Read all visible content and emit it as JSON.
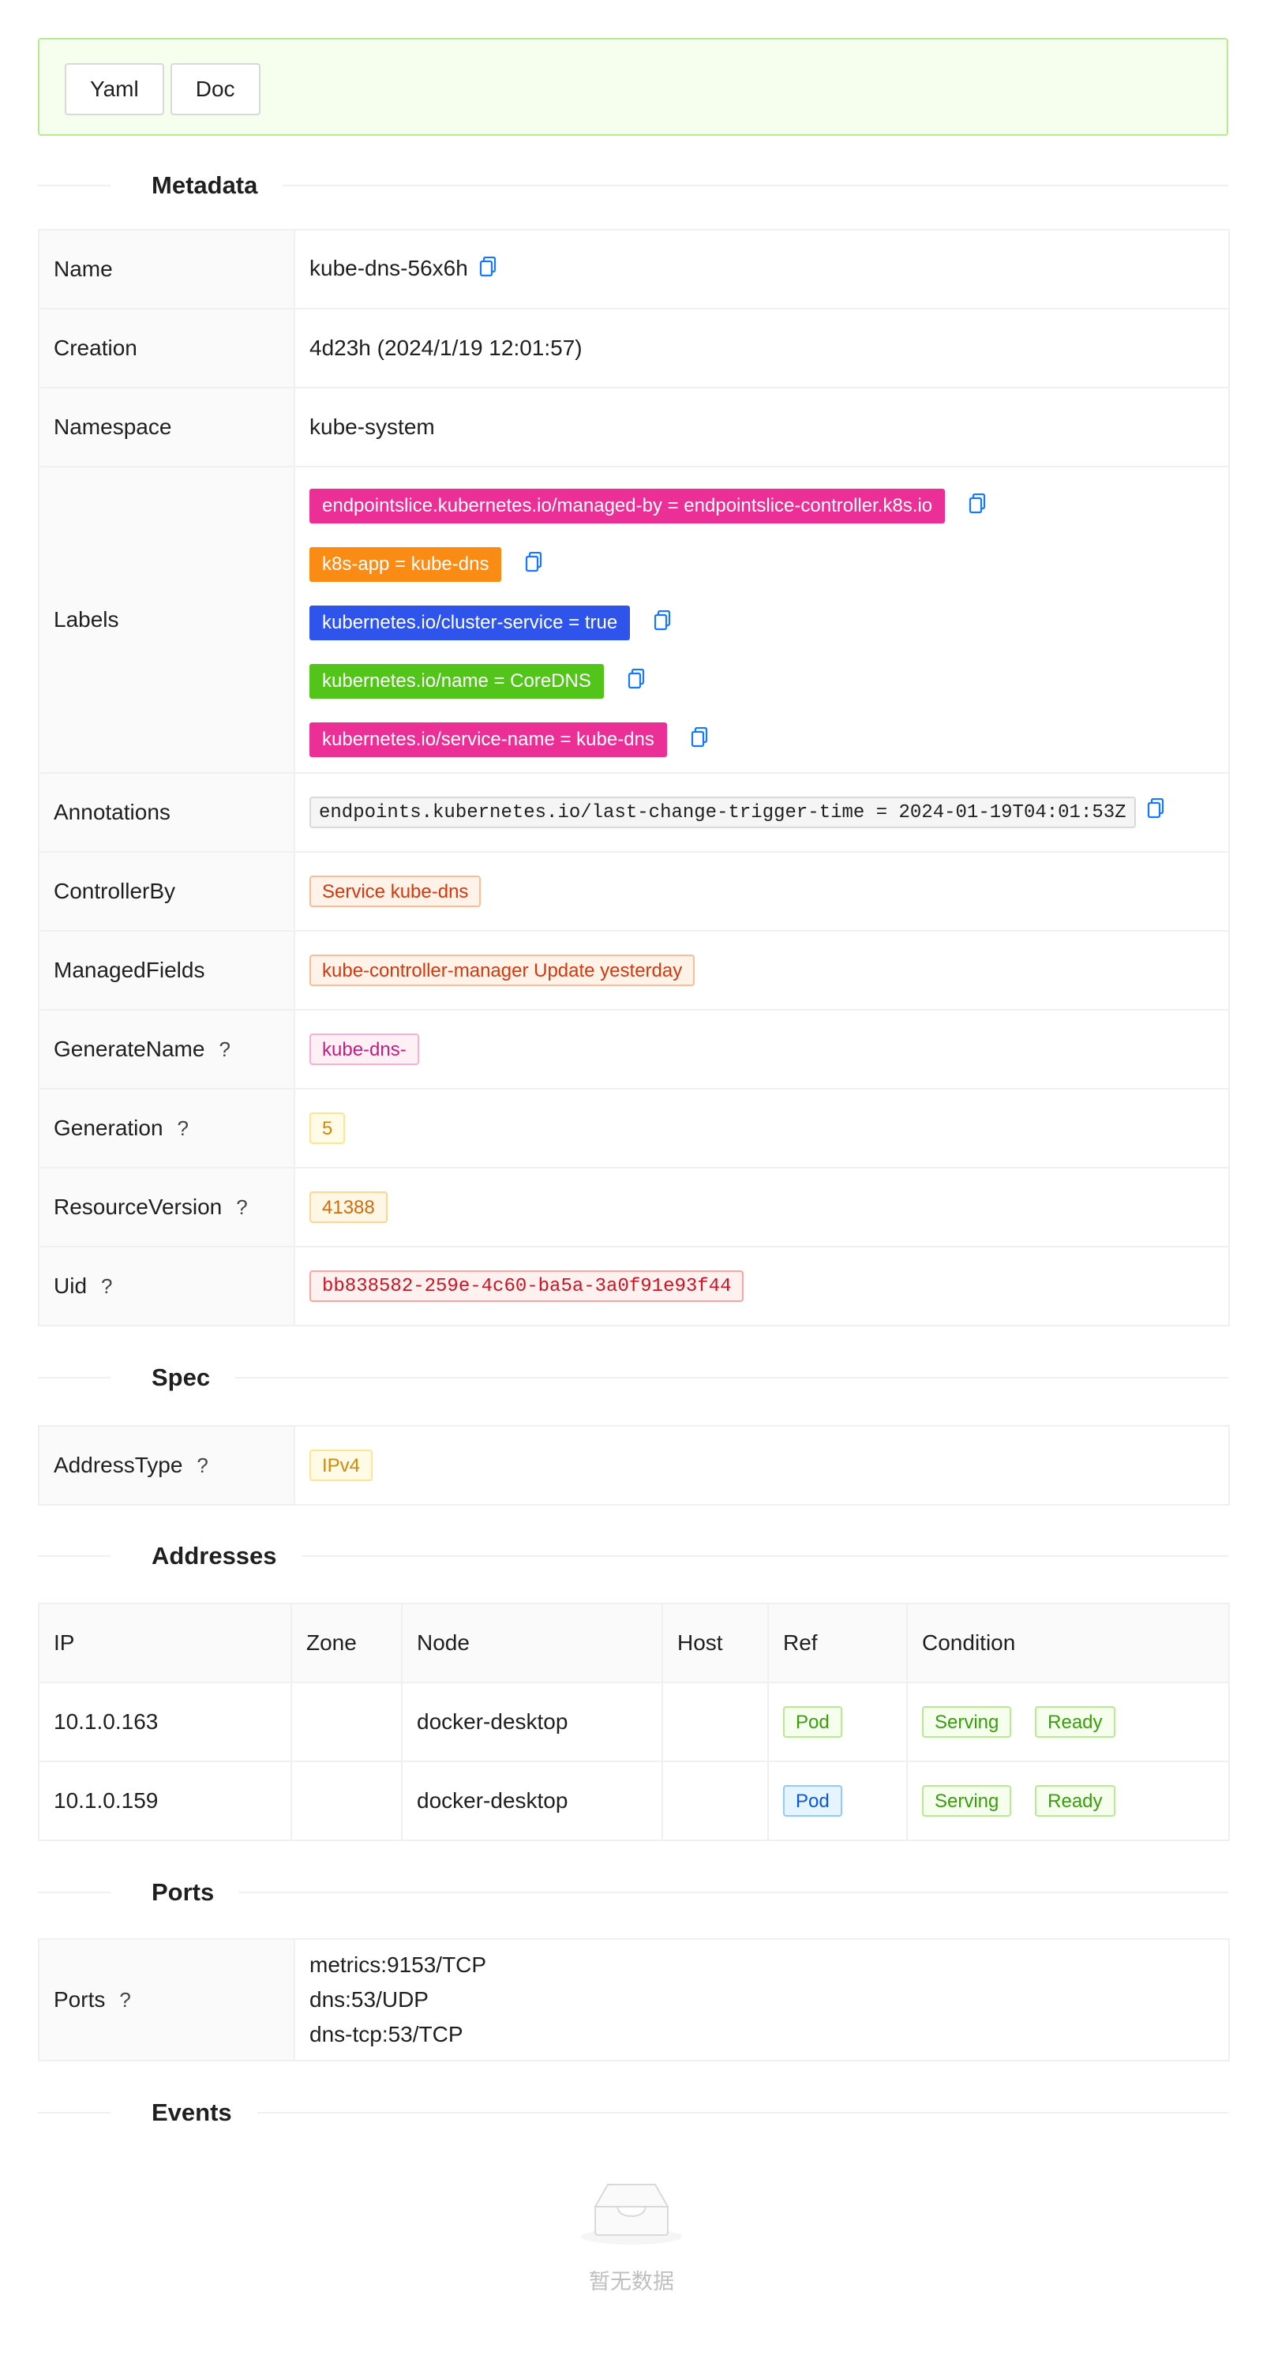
{
  "toolbar": {
    "yaml_label": "Yaml",
    "doc_label": "Doc"
  },
  "sections": {
    "metadata": "Metadata",
    "spec": "Spec",
    "addresses": "Addresses",
    "ports": "Ports",
    "events": "Events"
  },
  "metadata": {
    "name": {
      "label": "Name",
      "value": "kube-dns-56x6h"
    },
    "creation": {
      "label": "Creation",
      "value": "4d23h (2024/1/19 12:01:57)"
    },
    "namespace": {
      "label": "Namespace",
      "value": "kube-system"
    },
    "labels": {
      "label": "Labels",
      "items": [
        {
          "text": "endpointslice.kubernetes.io/managed-by = endpointslice-controller.k8s.io",
          "color": "#eb2f96"
        },
        {
          "text": "k8s-app = kube-dns",
          "color": "#fa8c16"
        },
        {
          "text": "kubernetes.io/cluster-service = true",
          "color": "#2f54eb"
        },
        {
          "text": "kubernetes.io/name = CoreDNS",
          "color": "#52c41a"
        },
        {
          "text": "kubernetes.io/service-name = kube-dns",
          "color": "#eb2f96"
        }
      ]
    },
    "annotations": {
      "label": "Annotations",
      "value": "endpoints.kubernetes.io/last-change-trigger-time = 2024-01-19T04:01:53Z"
    },
    "controller_by": {
      "label": "ControllerBy",
      "value": "Service kube-dns"
    },
    "managed_fields": {
      "label": "ManagedFields",
      "value": "kube-controller-manager Update yesterday"
    },
    "generate_name": {
      "label": "GenerateName",
      "value": "kube-dns-"
    },
    "generation": {
      "label": "Generation",
      "value": "5"
    },
    "resource_version": {
      "label": "ResourceVersion",
      "value": "41388"
    },
    "uid": {
      "label": "Uid",
      "value": "bb838582-259e-4c60-ba5a-3a0f91e93f44"
    },
    "help_glyph": "?"
  },
  "spec": {
    "address_type": {
      "label": "AddressType",
      "value": "IPv4"
    }
  },
  "addresses": {
    "columns": [
      "IP",
      "Zone",
      "Node",
      "Host",
      "Ref",
      "Condition"
    ],
    "rows": [
      {
        "ip": "10.1.0.163",
        "zone": "",
        "node": "docker-desktop",
        "host": "",
        "ref": "Pod",
        "conditions": [
          "Serving",
          "Ready"
        ]
      },
      {
        "ip": "10.1.0.159",
        "zone": "",
        "node": "docker-desktop",
        "host": "",
        "ref": "Pod",
        "conditions": [
          "Serving",
          "Ready"
        ]
      }
    ]
  },
  "ports": {
    "label": "Ports",
    "items": [
      "metrics:9153/TCP",
      "dns:53/UDP",
      "dns-tcp:53/TCP"
    ]
  },
  "events": {
    "empty_text": "暂无数据",
    "icon": "empty-inbox-icon"
  },
  "icons": {
    "copy": "copy-icon",
    "help": "help-icon"
  }
}
